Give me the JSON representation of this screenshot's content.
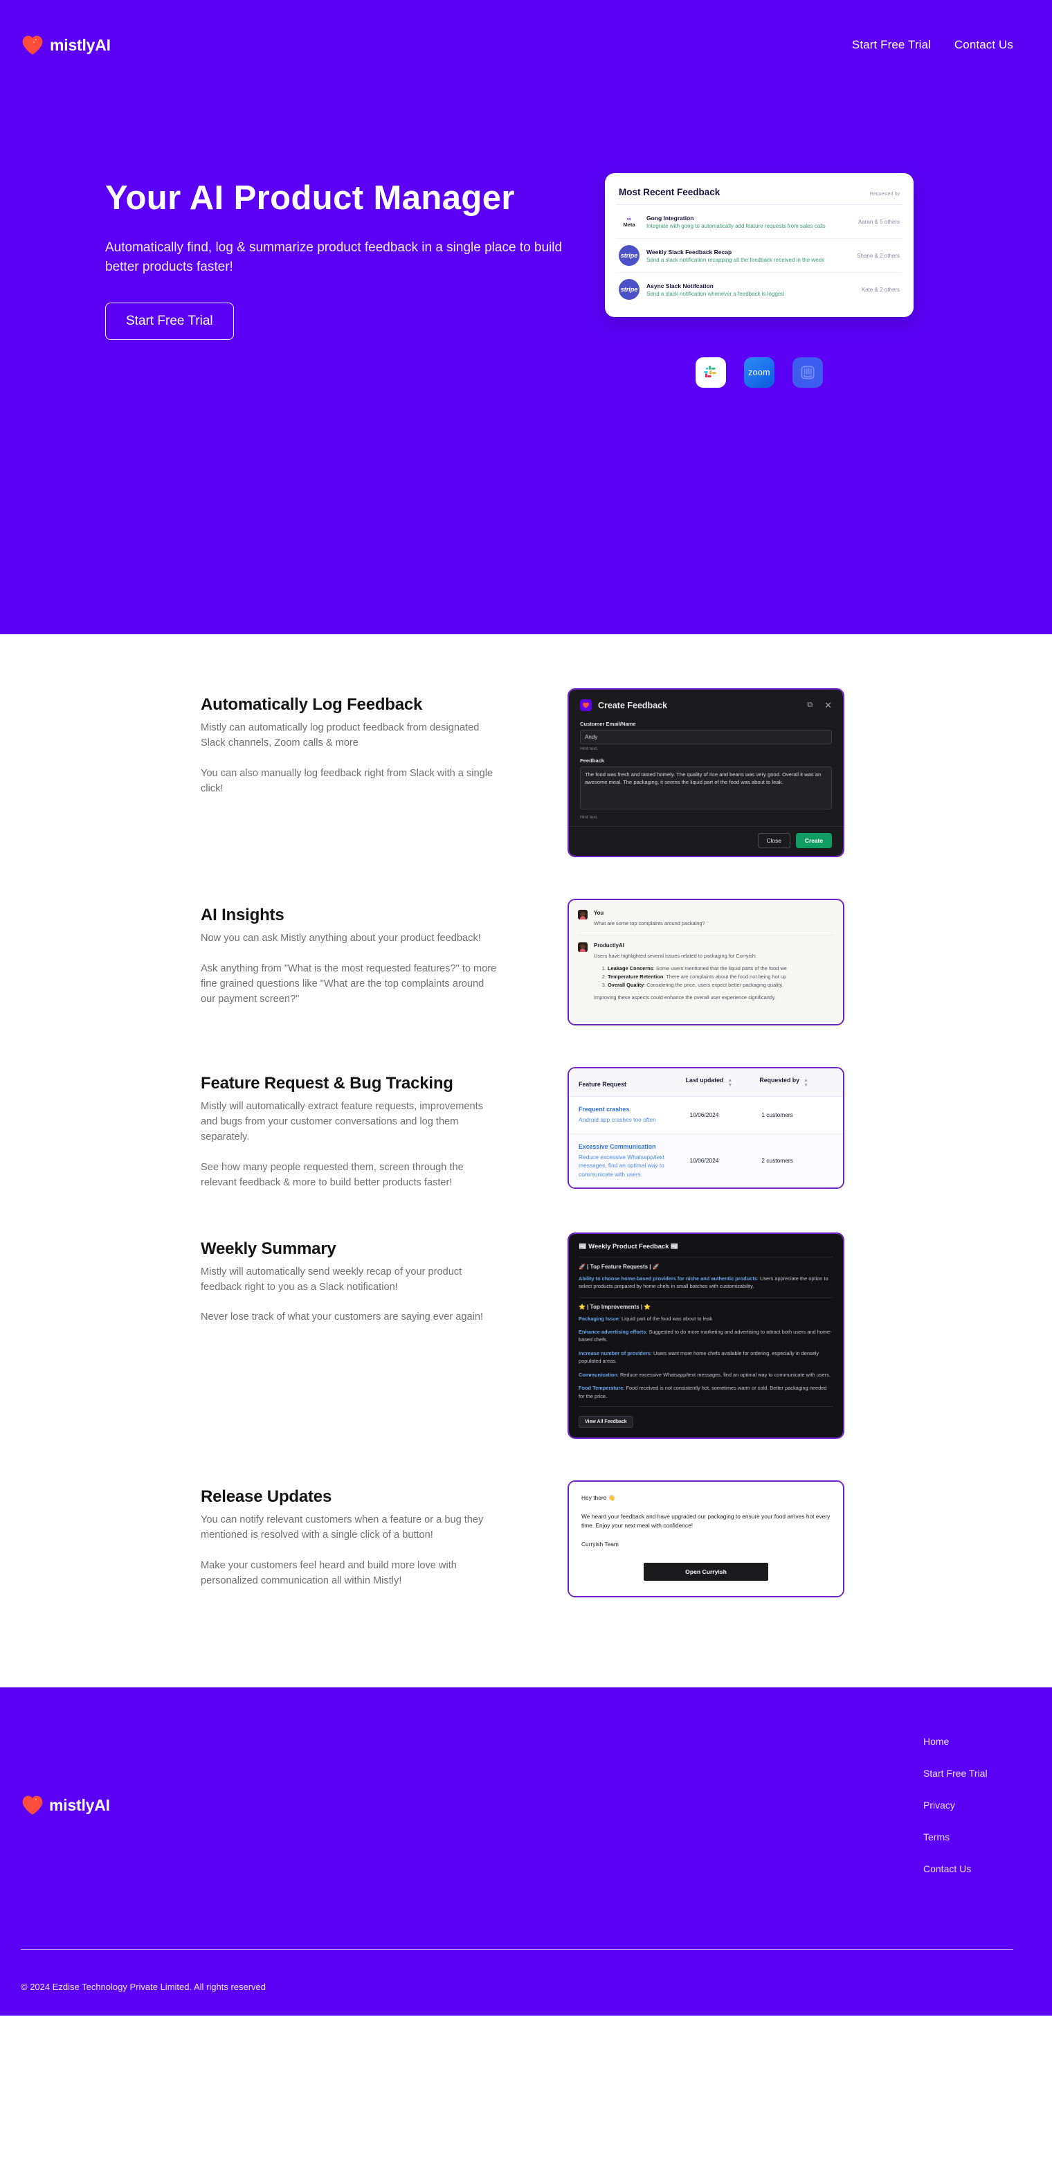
{
  "brand": {
    "name": "mistlyAI",
    "logo_icon": "heart-icon",
    "accent": "#5B00F5",
    "heart_color": "#FF4D3D"
  },
  "nav": {
    "links": [
      {
        "label": "Start Free Trial",
        "name": "nav-start-free-trial"
      },
      {
        "label": "Contact Us",
        "name": "nav-contact-us"
      }
    ]
  },
  "hero": {
    "title": "Your AI Product Manager",
    "subtitle": "Automatically find, log & summarize product feedback in a single place to build better products faster!",
    "cta_label": "Start Free Trial",
    "card": {
      "title": "Most Recent Feedback",
      "col_requested_by": "Requested by",
      "rows": [
        {
          "logo": "Meta",
          "logo_type": "meta",
          "title": "Gong Integration",
          "desc": "Integrate with gong to automatically add feature requests from sales calls",
          "by": "Aaran & 5 others"
        },
        {
          "logo": "stripe",
          "logo_type": "stripe",
          "title": "Weekly Slack Feedback Recap",
          "desc": "Send a slack notification recapping all the feedback received in the week",
          "by": "Shane & 2 others"
        },
        {
          "logo": "stripe",
          "logo_type": "stripe",
          "title": "Async Slack Notifcation",
          "desc": "Send a slack notification whenever a feedback is logged",
          "by": "Kate & 2 others"
        }
      ]
    },
    "integrations": [
      {
        "name": "slack-icon",
        "label": "Slack"
      },
      {
        "name": "zoom-icon",
        "label": "zoom"
      },
      {
        "name": "intercom-icon",
        "label": "Intercom"
      }
    ]
  },
  "features": [
    {
      "heading": "Automatically Log Feedback",
      "p1": "Mistly can automatically log product feedback from designated Slack channels, Zoom calls & more",
      "p2": "You can also manually log feedback right from Slack with a single click!"
    },
    {
      "heading": "AI Insights",
      "p1": "Now you can ask Mistly anything about your product feedback!",
      "p2": "Ask anything from \"What is the most requested features?\" to more fine grained questions like \"What are the top complaints around our payment screen?\""
    },
    {
      "heading": "Feature Request & Bug Tracking",
      "p1": "Mistly will automatically extract feature requests, improvements and bugs from your customer conversations and log them separately.",
      "p2": "See how many people requested them, screen through the relevant feedback & more to build better products  faster!"
    },
    {
      "heading": "Weekly Summary",
      "p1": "Mistly will automatically send weekly recap of your product feedback right to you as a Slack notification!",
      "p2": "Never lose track of what your customers are saying ever again!"
    },
    {
      "heading": "Release Updates",
      "p1": "You can notify relevant customers when a feature or a bug they mentioned is resolved with a single click of a button!",
      "p2": "Make your customers feel heard and build more love with personalized communication all within Mistly!"
    }
  ],
  "create_feedback_modal": {
    "title": "Create Feedback",
    "copy_icon": "copy-icon",
    "close_icon": "close-icon",
    "customer_label": "Customer Email/Name",
    "customer_value": "Andy",
    "customer_hint": "Hint text.",
    "feedback_label": "Feedback",
    "feedback_value": "The food was fresh and tasted homely. The quality of rice and beans was very good. Overall it was an awesome meal. The packaging, it seems the liquid part of the food was about to leak.",
    "feedback_hint": "Hint text.",
    "close_btn": "Close",
    "create_btn": "Create",
    "create_btn_color": "#0F9D63"
  },
  "ai_chat": {
    "user_name": "You",
    "user_message": "What are some top complaints around packaing?",
    "ai_name": "ProductlyAI",
    "ai_intro": "Users have highlighted several issues related to packaging for Curryish:",
    "ai_points": [
      {
        "term": "Leakage Concerns",
        "text": ": Some users mentioned that the liquid parts of the food we"
      },
      {
        "term": "Temperature Retention",
        "text": ": There are complaints about the food not being hot up"
      },
      {
        "term": "Overall Quality",
        "text": ": Considering the price, users expect better packaging quality."
      }
    ],
    "ai_outro": "Improving these aspects could enhance the overall user experience significantly."
  },
  "feature_table": {
    "columns": [
      "Feature Request",
      "Last updated",
      "Requested by"
    ],
    "rows": [
      {
        "title": "Frequent crashes",
        "desc": "Android app crashes too often",
        "updated": "10/06/2024",
        "requested_by": "1 customers"
      },
      {
        "title": "Excessive Communication",
        "desc": "Reduce excessive Whatsapp/text messages, find an optimal way to communicate with users.",
        "updated": "10/06/2024",
        "requested_by": "2 customers"
      }
    ]
  },
  "weekly_card": {
    "title": "📰 Weekly Product Feedback 📰",
    "section1_header": "🚀 | Top Feature Requests | 🚀",
    "section1_key": "Ability to choose home-based providers for niche and authentic products",
    "section1_text": ": Users appreciate the option to select products prepared by home chefs in small batches with customizability.",
    "section2_header": "⭐ | Top Improvements | ⭐",
    "items": [
      {
        "key": "Packaging Issue",
        "text": ": Liquid part of the food was about to leak"
      },
      {
        "key": "Enhance advertising efforts",
        "text": ": Suggested to do more marketing and advertising to attract both users and home-based chefs."
      },
      {
        "key": "Increase number of providers",
        "text": ": Users want more home chefs available for ordering, especially in densely populated areas."
      },
      {
        "key": "Communication",
        "text": ": Reduce excessive Whatsapp/text messages, find an optimal way to communicate with users."
      },
      {
        "key": "Food Temperature",
        "text": ": Food received is not consistently hot, sometimes warm or cold. Better packaging needed for the price."
      }
    ],
    "button": "View All Feedback"
  },
  "release_email": {
    "greeting": "Hey there 👋",
    "body": "We heard your feedback and have upgraded our packaging to ensure your food arrives hot every time. Enjoy your next meal with confidence!",
    "signature": "Curryish Team",
    "button": "Open Curryish"
  },
  "footer": {
    "brand": "mistlyAI",
    "links": [
      {
        "label": "Home",
        "name": "footer-link-home"
      },
      {
        "label": "Start Free Trial",
        "name": "footer-link-start-free-trial"
      },
      {
        "label": "Privacy",
        "name": "footer-link-privacy"
      },
      {
        "label": "Terms",
        "name": "footer-link-terms"
      },
      {
        "label": "Contact Us",
        "name": "footer-link-contact-us"
      }
    ],
    "copyright": "© 2024 Ezdise Technology Private Limited. All rights reserved"
  }
}
